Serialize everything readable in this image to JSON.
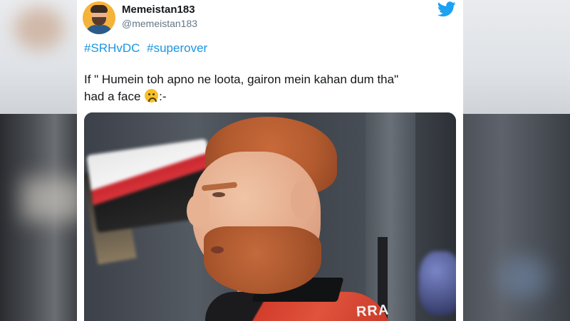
{
  "tweet": {
    "display_name": "Memeistan183",
    "handle": "@memeistan183",
    "hashtags": [
      "#SRHvDC",
      "#superover"
    ],
    "text_line1": "If \" Humein toh apno ne loota, gairon mein kahan dum tha\"",
    "text_line2_before": "had a face",
    "text_line2_after": ":-",
    "emoji": "slightly-frowning-face-emoji"
  },
  "media": {
    "jersey_text": "RRA"
  },
  "icons": {
    "brand": "twitter-bird-icon"
  },
  "colors": {
    "link": "#1b95e0",
    "twitter_blue": "#1da1f2",
    "text": "#14171a",
    "muted": "#657786"
  }
}
